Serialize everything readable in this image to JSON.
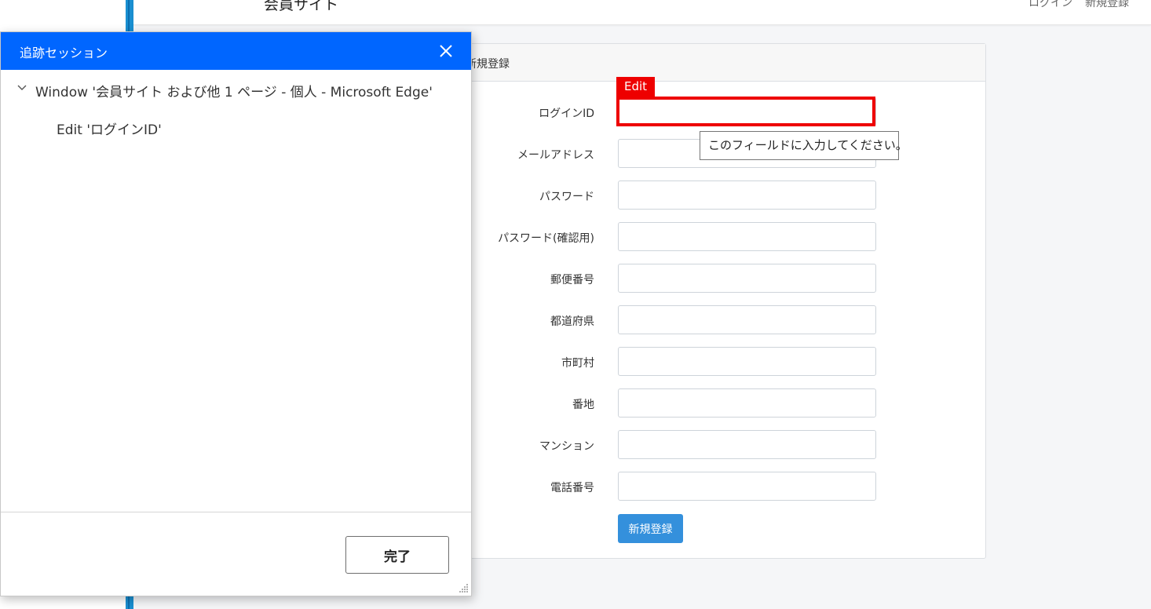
{
  "site": {
    "brand": "会員サイト",
    "nav": {
      "login": "ログイン",
      "register": "新規登録"
    },
    "card_header": "新規登録"
  },
  "form": {
    "fields": [
      {
        "label": "ログインID",
        "value": ""
      },
      {
        "label": "メールアドレス",
        "value": ""
      },
      {
        "label": "パスワード",
        "value": ""
      },
      {
        "label": "パスワード(確認用)",
        "value": ""
      },
      {
        "label": "郵便番号",
        "value": ""
      },
      {
        "label": "都道府県",
        "value": ""
      },
      {
        "label": "市町村",
        "value": ""
      },
      {
        "label": "番地",
        "value": ""
      },
      {
        "label": "マンション",
        "value": ""
      },
      {
        "label": "電話番号",
        "value": ""
      }
    ],
    "submit_label": "新規登録"
  },
  "highlight": {
    "label": "Edit",
    "tooltip": "このフィールドに入力してください。",
    "color": "#ee0000"
  },
  "panel": {
    "title": "追跡セッション",
    "tree": {
      "window_node": "Window '会員サイト および他 1 ページ - 個人 - Microsoft Edge'",
      "edit_node": "Edit 'ログインID'"
    },
    "done_label": "完了",
    "header_color": "#0066ff"
  }
}
